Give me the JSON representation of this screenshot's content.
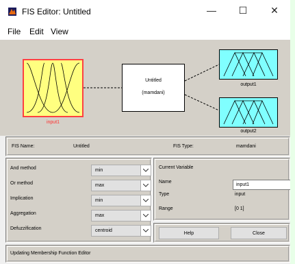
{
  "window": {
    "title": "FIS Editor: Untitled",
    "minimize": "—",
    "maximize": "☐",
    "close": "✕"
  },
  "menu": {
    "file": "File",
    "edit": "Edit",
    "view": "View"
  },
  "diagram": {
    "input_label": "input1",
    "system_name": "Untitled",
    "system_type": "(mamdani)",
    "output1_label": "output1",
    "output2_label": "output2"
  },
  "info": {
    "fis_name_label": "FIS Name:",
    "fis_name_value": "Untitled",
    "fis_type_label": "FIS Type:",
    "fis_type_value": "mamdani"
  },
  "methods": [
    {
      "label": "And method",
      "value": "min"
    },
    {
      "label": "Or method",
      "value": "max"
    },
    {
      "label": "Implication",
      "value": "min"
    },
    {
      "label": "Aggregation",
      "value": "max"
    },
    {
      "label": "Defuzzification",
      "value": "centroid"
    }
  ],
  "current_variable": {
    "heading": "Current Variable",
    "name_label": "Name",
    "name_value": "input1",
    "type_label": "Type",
    "type_value": "input",
    "range_label": "Range",
    "range_value": "[0 1]"
  },
  "buttons": {
    "help": "Help",
    "close": "Close"
  },
  "status": "Updating Membership Function Editor",
  "colors": {
    "input_fill": "#ffff80",
    "input_border": "#ff4040",
    "output_fill": "#80ffff",
    "diagram_bg": "#d4d0c8"
  }
}
